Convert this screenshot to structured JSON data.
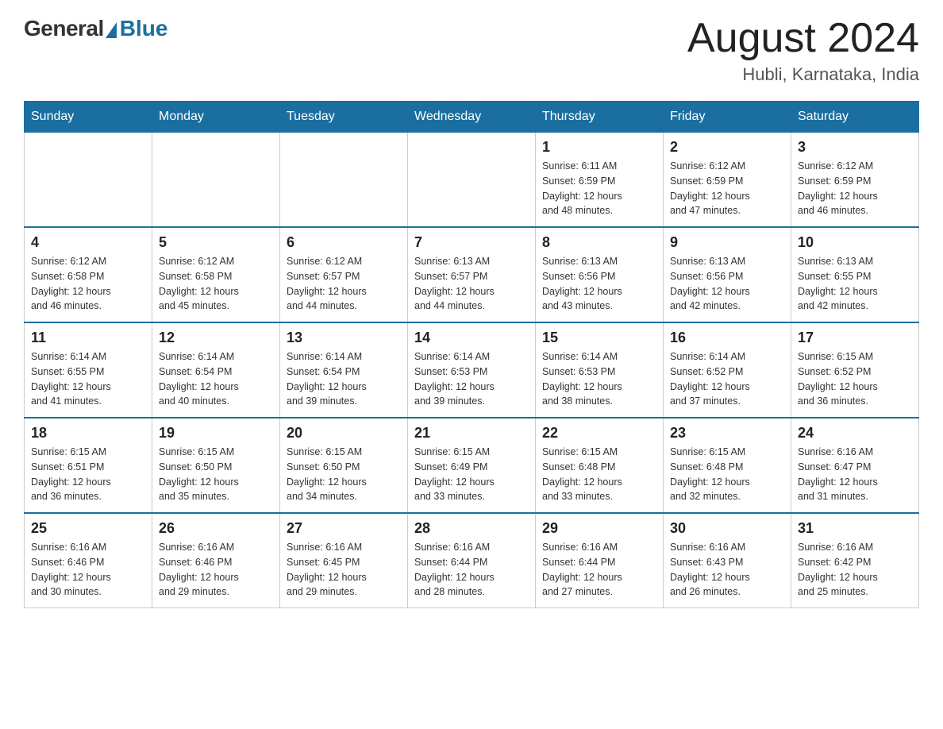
{
  "header": {
    "logo_general": "General",
    "logo_blue": "Blue",
    "month_title": "August 2024",
    "location": "Hubli, Karnataka, India"
  },
  "days_of_week": [
    "Sunday",
    "Monday",
    "Tuesday",
    "Wednesday",
    "Thursday",
    "Friday",
    "Saturday"
  ],
  "weeks": [
    [
      {
        "day": "",
        "info": ""
      },
      {
        "day": "",
        "info": ""
      },
      {
        "day": "",
        "info": ""
      },
      {
        "day": "",
        "info": ""
      },
      {
        "day": "1",
        "info": "Sunrise: 6:11 AM\nSunset: 6:59 PM\nDaylight: 12 hours\nand 48 minutes."
      },
      {
        "day": "2",
        "info": "Sunrise: 6:12 AM\nSunset: 6:59 PM\nDaylight: 12 hours\nand 47 minutes."
      },
      {
        "day": "3",
        "info": "Sunrise: 6:12 AM\nSunset: 6:59 PM\nDaylight: 12 hours\nand 46 minutes."
      }
    ],
    [
      {
        "day": "4",
        "info": "Sunrise: 6:12 AM\nSunset: 6:58 PM\nDaylight: 12 hours\nand 46 minutes."
      },
      {
        "day": "5",
        "info": "Sunrise: 6:12 AM\nSunset: 6:58 PM\nDaylight: 12 hours\nand 45 minutes."
      },
      {
        "day": "6",
        "info": "Sunrise: 6:12 AM\nSunset: 6:57 PM\nDaylight: 12 hours\nand 44 minutes."
      },
      {
        "day": "7",
        "info": "Sunrise: 6:13 AM\nSunset: 6:57 PM\nDaylight: 12 hours\nand 44 minutes."
      },
      {
        "day": "8",
        "info": "Sunrise: 6:13 AM\nSunset: 6:56 PM\nDaylight: 12 hours\nand 43 minutes."
      },
      {
        "day": "9",
        "info": "Sunrise: 6:13 AM\nSunset: 6:56 PM\nDaylight: 12 hours\nand 42 minutes."
      },
      {
        "day": "10",
        "info": "Sunrise: 6:13 AM\nSunset: 6:55 PM\nDaylight: 12 hours\nand 42 minutes."
      }
    ],
    [
      {
        "day": "11",
        "info": "Sunrise: 6:14 AM\nSunset: 6:55 PM\nDaylight: 12 hours\nand 41 minutes."
      },
      {
        "day": "12",
        "info": "Sunrise: 6:14 AM\nSunset: 6:54 PM\nDaylight: 12 hours\nand 40 minutes."
      },
      {
        "day": "13",
        "info": "Sunrise: 6:14 AM\nSunset: 6:54 PM\nDaylight: 12 hours\nand 39 minutes."
      },
      {
        "day": "14",
        "info": "Sunrise: 6:14 AM\nSunset: 6:53 PM\nDaylight: 12 hours\nand 39 minutes."
      },
      {
        "day": "15",
        "info": "Sunrise: 6:14 AM\nSunset: 6:53 PM\nDaylight: 12 hours\nand 38 minutes."
      },
      {
        "day": "16",
        "info": "Sunrise: 6:14 AM\nSunset: 6:52 PM\nDaylight: 12 hours\nand 37 minutes."
      },
      {
        "day": "17",
        "info": "Sunrise: 6:15 AM\nSunset: 6:52 PM\nDaylight: 12 hours\nand 36 minutes."
      }
    ],
    [
      {
        "day": "18",
        "info": "Sunrise: 6:15 AM\nSunset: 6:51 PM\nDaylight: 12 hours\nand 36 minutes."
      },
      {
        "day": "19",
        "info": "Sunrise: 6:15 AM\nSunset: 6:50 PM\nDaylight: 12 hours\nand 35 minutes."
      },
      {
        "day": "20",
        "info": "Sunrise: 6:15 AM\nSunset: 6:50 PM\nDaylight: 12 hours\nand 34 minutes."
      },
      {
        "day": "21",
        "info": "Sunrise: 6:15 AM\nSunset: 6:49 PM\nDaylight: 12 hours\nand 33 minutes."
      },
      {
        "day": "22",
        "info": "Sunrise: 6:15 AM\nSunset: 6:48 PM\nDaylight: 12 hours\nand 33 minutes."
      },
      {
        "day": "23",
        "info": "Sunrise: 6:15 AM\nSunset: 6:48 PM\nDaylight: 12 hours\nand 32 minutes."
      },
      {
        "day": "24",
        "info": "Sunrise: 6:16 AM\nSunset: 6:47 PM\nDaylight: 12 hours\nand 31 minutes."
      }
    ],
    [
      {
        "day": "25",
        "info": "Sunrise: 6:16 AM\nSunset: 6:46 PM\nDaylight: 12 hours\nand 30 minutes."
      },
      {
        "day": "26",
        "info": "Sunrise: 6:16 AM\nSunset: 6:46 PM\nDaylight: 12 hours\nand 29 minutes."
      },
      {
        "day": "27",
        "info": "Sunrise: 6:16 AM\nSunset: 6:45 PM\nDaylight: 12 hours\nand 29 minutes."
      },
      {
        "day": "28",
        "info": "Sunrise: 6:16 AM\nSunset: 6:44 PM\nDaylight: 12 hours\nand 28 minutes."
      },
      {
        "day": "29",
        "info": "Sunrise: 6:16 AM\nSunset: 6:44 PM\nDaylight: 12 hours\nand 27 minutes."
      },
      {
        "day": "30",
        "info": "Sunrise: 6:16 AM\nSunset: 6:43 PM\nDaylight: 12 hours\nand 26 minutes."
      },
      {
        "day": "31",
        "info": "Sunrise: 6:16 AM\nSunset: 6:42 PM\nDaylight: 12 hours\nand 25 minutes."
      }
    ]
  ]
}
